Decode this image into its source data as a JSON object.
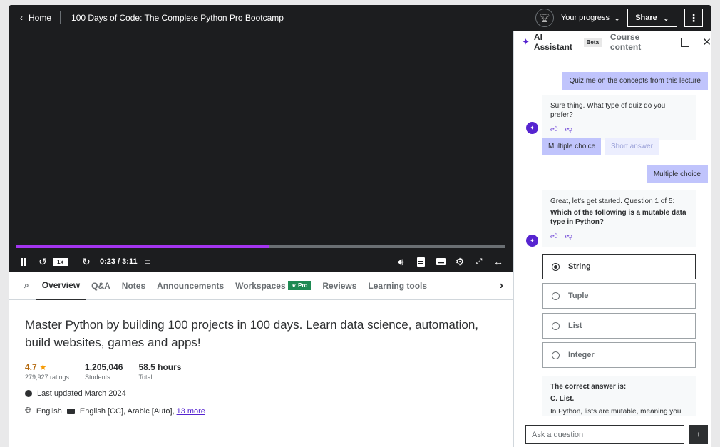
{
  "header": {
    "home_label": "Home",
    "course_title": "100 Days of Code: The Complete Python Pro Bootcamp",
    "progress_label": "Your progress",
    "share_label": "Share"
  },
  "player": {
    "progress": 0.518,
    "speed_label": "1x",
    "timecode": "0:23 / 3:11"
  },
  "tabs": [
    {
      "label": "Overview"
    },
    {
      "label": "Q&A"
    },
    {
      "label": "Notes"
    },
    {
      "label": "Announcements"
    },
    {
      "label": "Workspaces"
    },
    {
      "label": "Reviews"
    },
    {
      "label": "Learning tools"
    }
  ],
  "pro_badge": "★ Pro",
  "overview": {
    "headline": "Master Python by building 100 projects in 100 days. Learn data science, automation, build websites, games and apps!",
    "rating": "4.7",
    "ratings_count": "279,927 ratings",
    "students": "1,205,046",
    "students_label": "Students",
    "hours": "58.5 hours",
    "hours_label": "Total",
    "last_updated": "Last updated March 2024",
    "language": "English",
    "captions": "English [CC], Arabic [Auto],",
    "more_link": "13 more"
  },
  "panel": {
    "ai_title": "AI Assistant",
    "beta_label": "Beta",
    "course_content": "Course content",
    "user_msg_1": "Quiz me on the concepts from this lecture",
    "bot_msg_1": "Sure thing. What type of quiz do you prefer?",
    "chip_multiple": "Multiple choice",
    "chip_short": "Short answer",
    "user_msg_2": "Multiple choice",
    "bot_msg_2_intro": "Great, let's get started. Question 1 of 5:",
    "bot_msg_2_question": "Which of the following is a mutable data type in Python?",
    "options": [
      "String",
      "Tuple",
      "List",
      "Integer"
    ],
    "answer_title": "The correct answer is:",
    "answer_value": "C. List.",
    "answer_explain": "In Python, lists are mutable, meaning you can change their elements, add new",
    "ask_placeholder": "Ask a question"
  }
}
